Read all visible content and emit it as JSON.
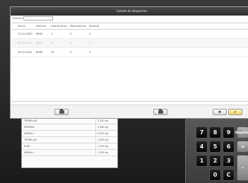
{
  "dialog": {
    "title": "Listado de despachos",
    "filter_label": "Número",
    "filter_value": "",
    "columns": [
      "Fecha",
      "Número",
      "Operaciones",
      "Movimientos",
      "Balanza"
    ],
    "rows": [
      {
        "fecha": "12.01.2020",
        "numero": "8083",
        "operaciones": "1",
        "movimientos": "5",
        "balanza": "1",
        "dimmed": false
      },
      {
        "fecha": "09.01.2023",
        "numero": "8081",
        "operaciones": "6",
        "movimientos": "5",
        "balanza": "1",
        "dimmed": true
      },
      {
        "fecha": "29.12.2022",
        "numero": "8080",
        "operaciones": "70",
        "movimientos": "3",
        "balanza": "1",
        "dimmed": false
      }
    ],
    "buttons": {
      "print_left": "printer-icon",
      "print_center": "printer-icon",
      "close_glyph": "✖",
      "accept_glyph": "✔"
    },
    "accent": "#f0d060"
  },
  "background": {
    "list": [
      {
        "name": "TERNILLAS",
        "weight": "3,320 kg"
      },
      {
        "name": "PAPERAL",
        "weight": "5,080 kg"
      },
      {
        "name": "ARREA.1",
        "weight": "0,250 kg"
      },
      {
        "name": "TERNILLAS",
        "weight": "1,280 kg"
      },
      {
        "name": "AUDI",
        "weight": "1,230 kg"
      },
      {
        "name": "ARREA.1",
        "weight": "1,230 kg"
      }
    ],
    "keypad": {
      "keys": [
        "7",
        "8",
        "9",
        "4",
        "5",
        "6",
        "1",
        "2",
        "3",
        "0",
        "C"
      ],
      "side_label": "Bloq/Elim"
    }
  }
}
